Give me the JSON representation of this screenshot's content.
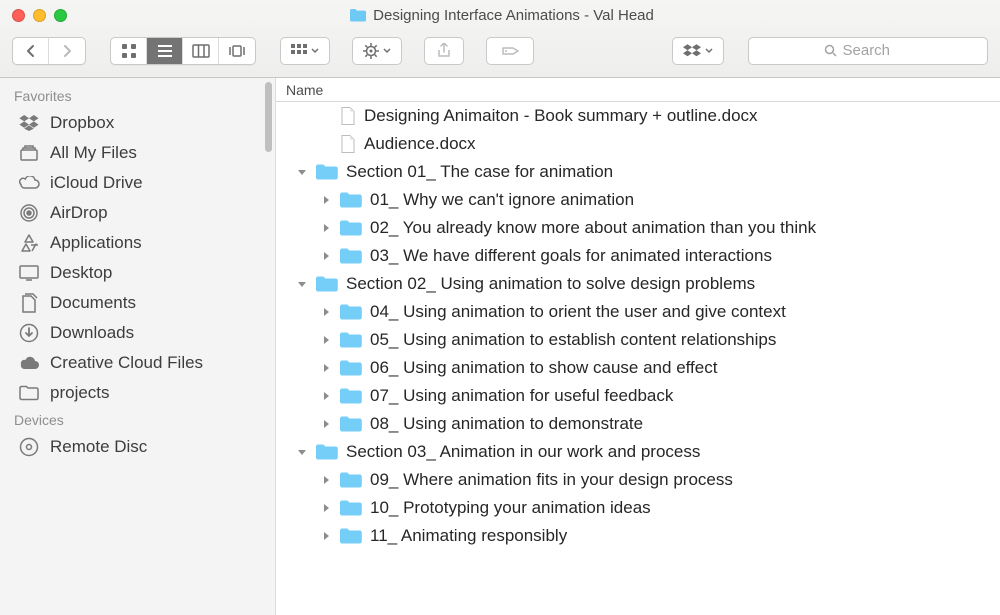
{
  "window": {
    "title": "Designing Interface Animations - Val Head"
  },
  "toolbar": {
    "search_placeholder": "Search"
  },
  "sidebar": {
    "groups": [
      {
        "label": "Favorites",
        "items": [
          {
            "icon": "dropbox",
            "label": "Dropbox"
          },
          {
            "icon": "allfiles",
            "label": "All My Files"
          },
          {
            "icon": "icloud",
            "label": "iCloud Drive"
          },
          {
            "icon": "airdrop",
            "label": "AirDrop"
          },
          {
            "icon": "apps",
            "label": "Applications"
          },
          {
            "icon": "desktop",
            "label": "Desktop"
          },
          {
            "icon": "documents",
            "label": "Documents"
          },
          {
            "icon": "downloads",
            "label": "Downloads"
          },
          {
            "icon": "cc",
            "label": "Creative Cloud Files"
          },
          {
            "icon": "folder",
            "label": "projects"
          }
        ]
      },
      {
        "label": "Devices",
        "items": [
          {
            "icon": "disc",
            "label": "Remote Disc"
          }
        ]
      }
    ]
  },
  "list": {
    "column_header": "Name",
    "rows": [
      {
        "level": 1,
        "type": "file",
        "name": " Designing Animaiton - Book summary + outline.docx"
      },
      {
        "level": 1,
        "type": "file",
        "name": "Audience.docx"
      },
      {
        "level": 0,
        "type": "folder",
        "expanded": true,
        "name": "Section 01_ The case for animation"
      },
      {
        "level": 1,
        "type": "folder",
        "expanded": false,
        "name": "01_ Why we can't ignore animation"
      },
      {
        "level": 1,
        "type": "folder",
        "expanded": false,
        "name": "02_ You already know more about animation than you think"
      },
      {
        "level": 1,
        "type": "folder",
        "expanded": false,
        "name": "03_ We have different goals for animated interactions"
      },
      {
        "level": 0,
        "type": "folder",
        "expanded": true,
        "name": "Section 02_ Using animation to solve design problems"
      },
      {
        "level": 1,
        "type": "folder",
        "expanded": false,
        "name": "04_ Using animation to orient the user and give context"
      },
      {
        "level": 1,
        "type": "folder",
        "expanded": false,
        "name": "05_ Using animation to establish content relationships"
      },
      {
        "level": 1,
        "type": "folder",
        "expanded": false,
        "name": "06_ Using animation to show cause and effect"
      },
      {
        "level": 1,
        "type": "folder",
        "expanded": false,
        "name": "07_ Using animation for useful feedback"
      },
      {
        "level": 1,
        "type": "folder",
        "expanded": false,
        "name": "08_ Using animation to demonstrate"
      },
      {
        "level": 0,
        "type": "folder",
        "expanded": true,
        "name": "Section 03_ Animation in our work and process"
      },
      {
        "level": 1,
        "type": "folder",
        "expanded": false,
        "name": "09_  Where animation fits in your design process"
      },
      {
        "level": 1,
        "type": "folder",
        "expanded": false,
        "name": "10_  Prototyping your animation ideas"
      },
      {
        "level": 1,
        "type": "folder",
        "expanded": false,
        "name": "11_ Animating responsibly"
      }
    ]
  }
}
